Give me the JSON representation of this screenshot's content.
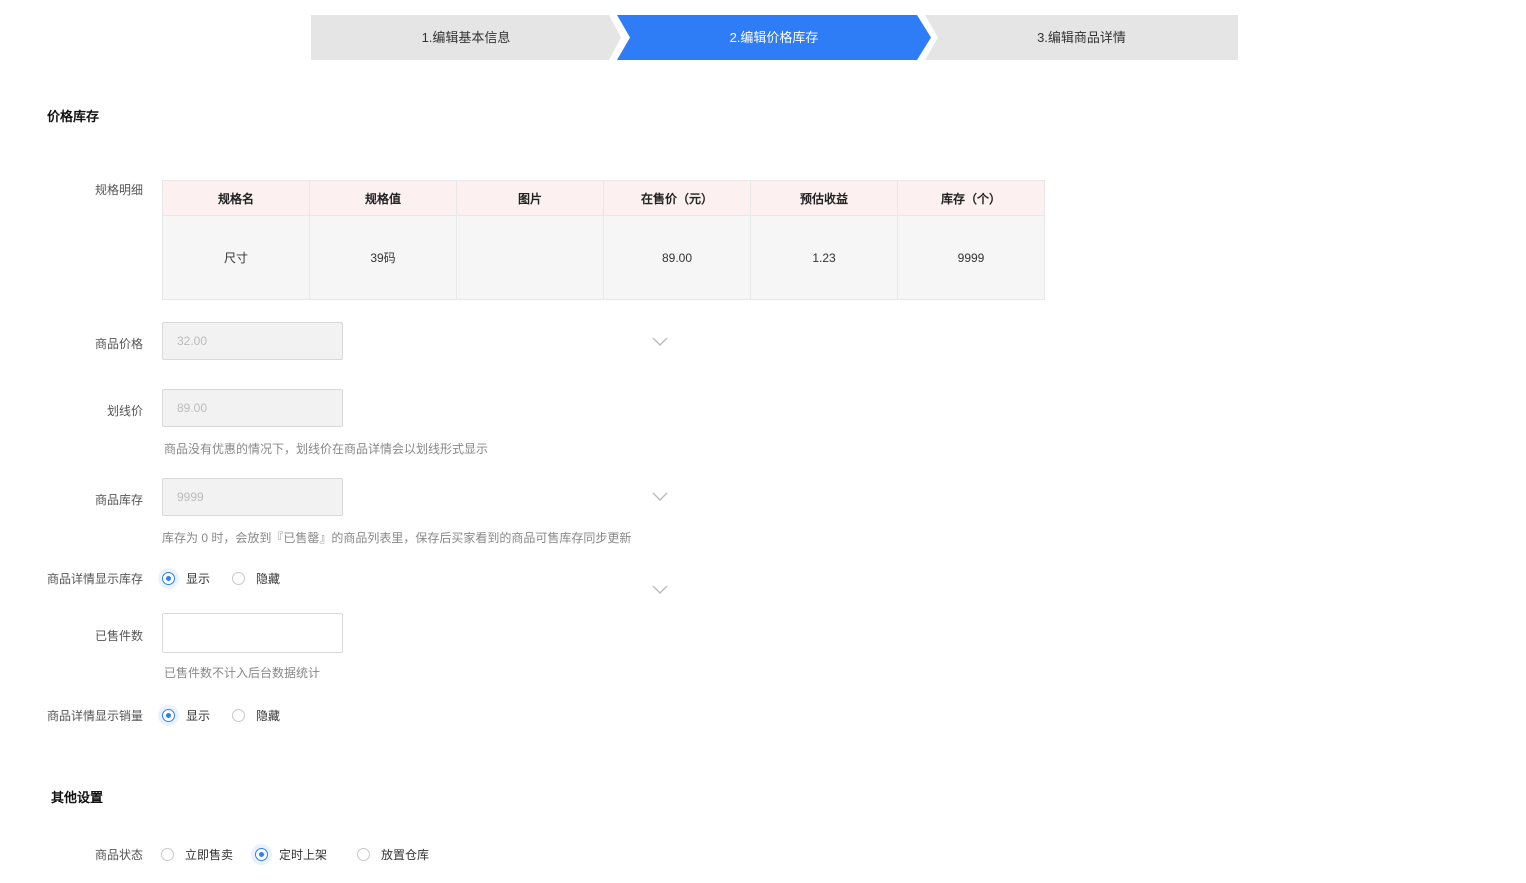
{
  "steps": [
    {
      "label": "1.编辑基本信息",
      "active": false
    },
    {
      "label": "2.编辑价格库存",
      "active": true
    },
    {
      "label": "3.编辑商品详情",
      "active": false
    }
  ],
  "colors": {
    "accent": "#2f7df6",
    "step_inactive": "#e5e5e5",
    "table_header": "#fdf0f0"
  },
  "price_stock": {
    "title": "价格库存",
    "spec_label": "规格明细",
    "table": {
      "headers": [
        "规格名",
        "规格值",
        "图片",
        "在售价（元）",
        "预估收益",
        "库存（个）"
      ],
      "rows": [
        [
          "尺寸",
          "39码",
          "",
          "89.00",
          "1.23",
          "9999"
        ]
      ]
    },
    "price": {
      "label": "商品价格",
      "value": "32.00"
    },
    "original_price": {
      "label": "划线价",
      "value": "89.00",
      "hint": "商品没有优惠的情况下，划线价在商品详情会以划线形式显示"
    },
    "stock": {
      "label": "商品库存",
      "value": "9999",
      "hint": "库存为 0 时，会放到『已售罄』的商品列表里，保存后买家看到的商品可售库存同步更新"
    },
    "show_stock": {
      "label": "商品详情显示库存",
      "options": [
        "显示",
        "隐藏"
      ],
      "selected": "显示"
    },
    "sold": {
      "label": "已售件数",
      "value": "",
      "hint": "已售件数不计入后台数据统计"
    },
    "show_sales": {
      "label": "商品详情显示销量",
      "options": [
        "显示",
        "隐藏"
      ],
      "selected": "显示"
    }
  },
  "other": {
    "title": "其他设置",
    "status": {
      "label": "商品状态",
      "options": [
        "立即售卖",
        "定时上架",
        "放置仓库"
      ],
      "selected": "定时上架"
    }
  }
}
